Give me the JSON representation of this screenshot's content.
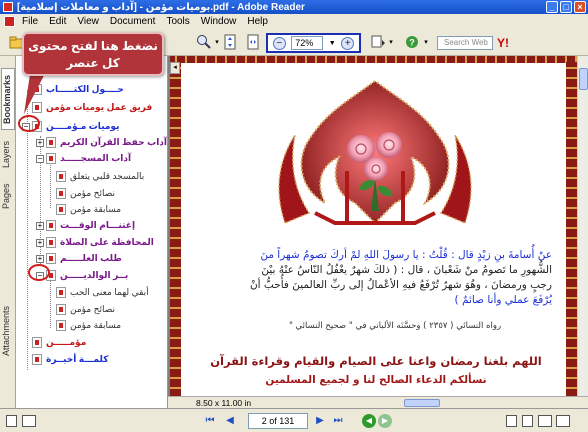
{
  "window": {
    "title": "بوميات مؤمن - [آداب و معاملات إسلامية].pdf - Adobe Reader"
  },
  "menu": [
    "File",
    "Edit",
    "View",
    "Document",
    "Tools",
    "Window",
    "Help"
  ],
  "toolbar": {
    "zoom_value": "72%",
    "zoom_out": "−",
    "zoom_in": "+",
    "search_placeholder": "Search Web",
    "yahoo": "Y!"
  },
  "callout": {
    "line1": "نضغط هنا لفتح محتوى",
    "line2": "كل عنصر"
  },
  "side_tabs": [
    "Bookmarks",
    "Layers",
    "Pages",
    "Attachments"
  ],
  "bookmarks": [
    {
      "label": "حــــول الكتـــــاب",
      "color": "blue"
    },
    {
      "label": "فريق عمل يوميات مؤمن",
      "color": "red"
    },
    {
      "label": "يوميات مـؤمــــن",
      "color": "blue"
    },
    {
      "label": "آداب حفظ القرآن الكريم",
      "color": "purple"
    },
    {
      "label": "آداب المسجـــــد",
      "color": "purple"
    },
    {
      "label": "بالمسجد قلبي يتعلق",
      "color": "dark"
    },
    {
      "label": "نصائح مؤمن",
      "color": "dark"
    },
    {
      "label": "مسابقة مؤمن",
      "color": "dark"
    },
    {
      "label": "إغتنـــام الوقـــت",
      "color": "purple"
    },
    {
      "label": "المحافظة على الصلاة",
      "color": "purple"
    },
    {
      "label": "طلب العلـــــم",
      "color": "purple"
    },
    {
      "label": "بــر الوالديـــــن",
      "color": "purple"
    },
    {
      "label": "أبقي لهما معنى الحب",
      "color": "dark"
    },
    {
      "label": "نصائح مؤمن",
      "color": "dark"
    },
    {
      "label": "مسابقة مؤمن",
      "color": "dark"
    },
    {
      "label": "مؤمـــــن",
      "color": "red"
    },
    {
      "label": "كلمـــة أخيــرة",
      "color": "blue"
    }
  ],
  "document": {
    "hadith_lines": [
      "عنْ أُسامةَ بنِ زيْدٍ قال : قُلْتُ : يا رسولَ اللهِ لمْ أركَ تصومُ شهراً منَ",
      "الشُّهورِ ما تَصومُ منْ شَعْبانَ ، قال : ( ذلكَ شهرٌ يغْفُلُ النّاسُ عنْهُ بيْنَ",
      "رجبٍ ورمضانَ ، وهُوَ شهرٌ تُرْفَعُ فيهِ الأعْمالُ إلى ربِّ العالمينَ فأُحبُّ أنْ",
      "يُرْفَعَ عملي وأنا صائمٌ )"
    ],
    "hadith_source": "رواه النسائي ( ٢٣٥٧ ) وحسَّنَه الألباني في \" صحيح النسائي \"",
    "dua_line1": "اللهم بلغنا رمضان واعنا على الصيام والقيام وقراءة القرآن",
    "dua_line2": "نسألكم الدعاء الصالح لنا و لجميع المسلمين",
    "page_size": "8.50 x 11.00 in"
  },
  "status": {
    "page_field": "2 of 131"
  },
  "colors": {
    "callout_bg": "#b0343a",
    "zoom_highlight": "#1a2fb5",
    "hadith_text": "#1b2fd4",
    "dua_text": "#8a1414",
    "page_border": "#8a1a14"
  }
}
